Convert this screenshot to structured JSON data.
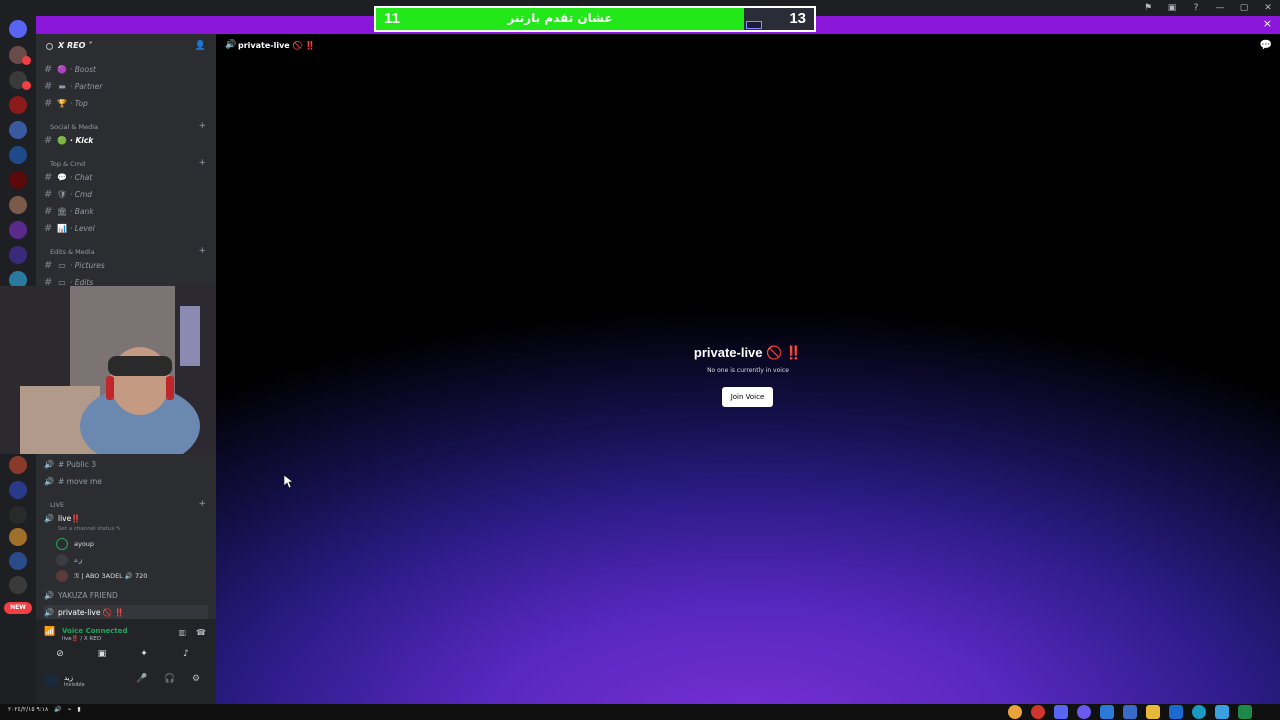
{
  "overlay": {
    "left_score": "11",
    "right_score": "13",
    "caption": "عشان تقدم بارتنر",
    "progress_fraction": 0.84
  },
  "window": {
    "banner_close": "×",
    "title_icons": [
      "flag-icon",
      "inbox-icon",
      "help-icon",
      "minimize-icon",
      "maximize-icon",
      "close-icon"
    ]
  },
  "server": {
    "name": "X REO ˅"
  },
  "channels": [
    {
      "emoji": "🟣",
      "label": "· Boost",
      "active": false
    },
    {
      "emoji": "▬",
      "label": "· Partner",
      "active": false
    },
    {
      "emoji": "🏆",
      "label": "· Top",
      "active": false
    },
    {
      "emoji": "🟢",
      "label": "· Kick",
      "active": true
    },
    {
      "emoji": "💬",
      "label": "· Chat",
      "active": false
    },
    {
      "emoji": "🛡",
      "label": "· Cmd",
      "active": false
    },
    {
      "emoji": "🏛",
      "label": "· Bank",
      "active": false
    },
    {
      "emoji": "📊",
      "label": "· Level",
      "active": false
    },
    {
      "emoji": "▭",
      "label": "· Pictures",
      "active": false
    },
    {
      "emoji": "▭",
      "label": "· Edits",
      "active": false
    }
  ],
  "categories": {
    "social": "Social & Media",
    "top": "Top & Cmd",
    "edits": "Edits & Media",
    "live": "LIVE"
  },
  "voice_channels": {
    "public3": "# Public 3",
    "moveme": "# move me",
    "live": "live‼️",
    "live_status": "Set a channel status ✎",
    "yakuza": "YAKUZA FRIEND",
    "private": "private-live 🚫 ‼️"
  },
  "voice_users": [
    {
      "name": "ayoup"
    },
    {
      "name": "ز.د"
    },
    {
      "name": "ℛ | ABO 3ADEL 🔊 720"
    }
  ],
  "voice_panel": {
    "status": "Voice Connected",
    "sub": "live‼️ / X REO",
    "user_name": "زيد",
    "user_state": "Invisible"
  },
  "main": {
    "channel_title": "private-live 🚫 ‼️",
    "center_title": "private-live 🚫 ‼️",
    "center_sub": "No one is currently in voice",
    "join_button": "Join Voice"
  },
  "taskbar": {
    "clock": "٩:١٨",
    "date": "٢٠٢٤/٢/١٥"
  }
}
